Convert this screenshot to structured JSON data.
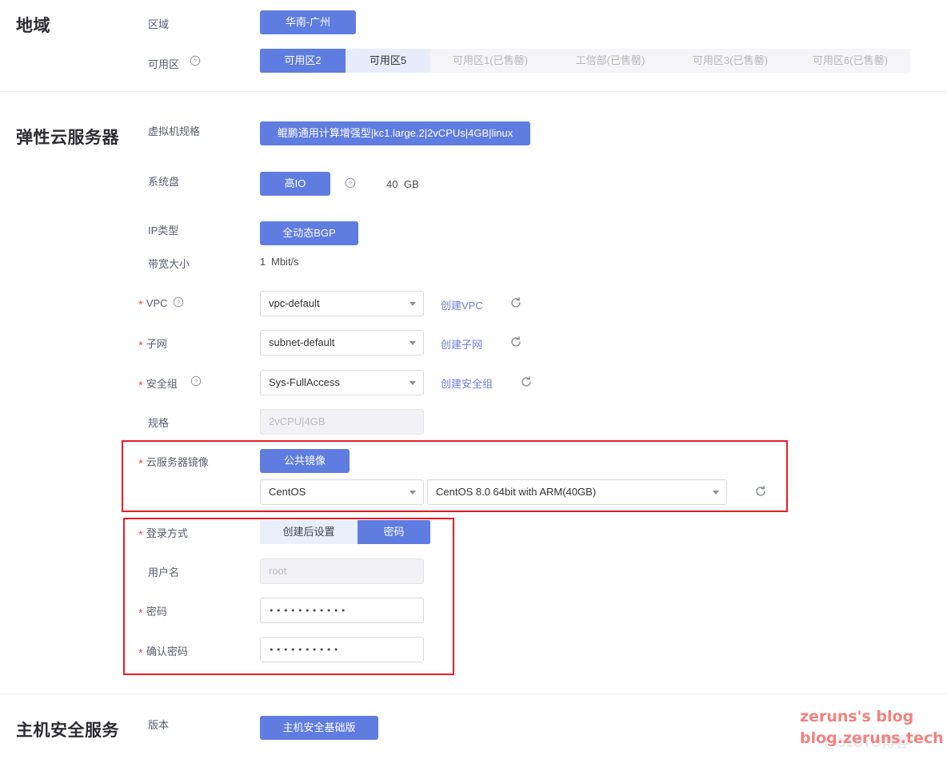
{
  "sections": {
    "region": {
      "title": "地域",
      "rows": {
        "region": {
          "label": "区域",
          "value": "华南-广州"
        },
        "az": {
          "label": "可用区",
          "help_icon": "help-circle-icon",
          "tabs": [
            {
              "label": "可用区2",
              "state": "active"
            },
            {
              "label": "可用区5",
              "state": "selectable"
            },
            {
              "label": "可用区1(已售罄)",
              "state": "disabled"
            },
            {
              "label": "工信部(已售罄)",
              "state": "disabled"
            },
            {
              "label": "可用区3(已售罄)",
              "state": "disabled"
            },
            {
              "label": "可用区6(已售罄)",
              "state": "disabled"
            }
          ]
        }
      }
    },
    "ecs": {
      "title": "弹性云服务器",
      "rows": {
        "flavor": {
          "label": "虚拟机规格",
          "value": "鲲鹏通用计算增强型|kc1.large.2|2vCPUs|4GB|linux"
        },
        "system_disk": {
          "label": "系统盘",
          "value": "高IO",
          "help_icon": "help-circle-icon",
          "size": "40",
          "size_unit": "GB"
        },
        "ip_type": {
          "label": "IP类型",
          "value": "全动态BGP"
        },
        "bandwidth": {
          "label": "带宽大小",
          "value": "1",
          "unit": "Mbit/s"
        },
        "vpc": {
          "label": "VPC",
          "required": true,
          "help_icon": "help-circle-icon",
          "value": "vpc-default",
          "link": "创建VPC",
          "refresh_icon": "refresh-icon"
        },
        "subnet": {
          "label": "子网",
          "required": true,
          "value": "subnet-default",
          "link": "创建子网",
          "refresh_icon": "refresh-icon"
        },
        "security_group": {
          "label": "安全组",
          "required": true,
          "help_icon": "help-circle-icon",
          "value": "Sys-FullAccess",
          "link": "创建安全组",
          "refresh_icon": "refresh-icon"
        },
        "spec": {
          "label": "规格",
          "value": "2vCPU|4GB",
          "readonly": true
        },
        "image": {
          "label": "云服务器镜像",
          "required": true,
          "source_button": "公共镜像",
          "os_family": "CentOS",
          "os_version": "CentOS 8.0 64bit with ARM(40GB)",
          "refresh_icon": "refresh-icon"
        },
        "login_mode": {
          "label": "登录方式",
          "required": true,
          "options": [
            {
              "label": "创建后设置",
              "state": "inactive"
            },
            {
              "label": "密码",
              "state": "active"
            }
          ]
        },
        "username": {
          "label": "用户名",
          "value": "root",
          "readonly": true
        },
        "password": {
          "label": "密码",
          "required": true,
          "value": "•••••••••••"
        },
        "confirm_password": {
          "label": "确认密码",
          "required": true,
          "value": "••••••••••"
        }
      }
    },
    "hss": {
      "title": "主机安全服务",
      "rows": {
        "edition": {
          "label": "版本",
          "value": "主机安全基础版"
        }
      }
    }
  },
  "annotations": {
    "image_highlight": "red-highlight-box",
    "login_highlight": "red-highlight-box"
  },
  "watermark": {
    "line1": "zeruns's blog",
    "line2": "blog.zeruns.tech",
    "ghost": "@51CTO博客"
  },
  "colors": {
    "accent_blue": "#5f7ce0",
    "tab_selectable": "#e6ecfa",
    "tab_disabled_bg": "#f5f5f7",
    "tab_disabled_text": "#b6b8bf",
    "required_red": "#f5544b",
    "annotation_red": "#ee1c25",
    "link_blue": "#6b7fd9",
    "watermark_pink": "#f4817f",
    "divider": "#ededf0"
  }
}
